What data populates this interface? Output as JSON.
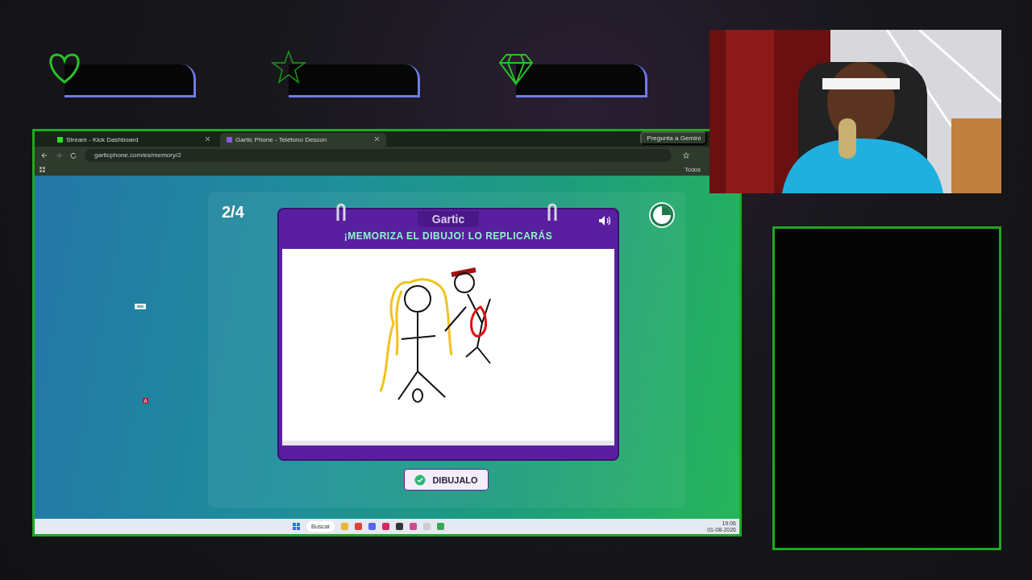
{
  "browser": {
    "tabs": [
      {
        "label": "Stream - Kick Dashboard",
        "selected": false
      },
      {
        "label": "Gartic Phone - Teléfono Descon",
        "selected": true
      }
    ],
    "url": "garticphone.com/es/memory/2",
    "gemini_button": "Pregunta a Gemini",
    "bookmarks_folder": "Todos"
  },
  "game": {
    "round": "2/4",
    "logo": "Gartic",
    "instruction": "¡MEMORIZA EL DIBUJO! LO REPLICARÁS",
    "button": "DIBUJALO"
  },
  "taskbar": {
    "search": "Buscar",
    "time": "19:06",
    "date": "01-08-2026"
  }
}
